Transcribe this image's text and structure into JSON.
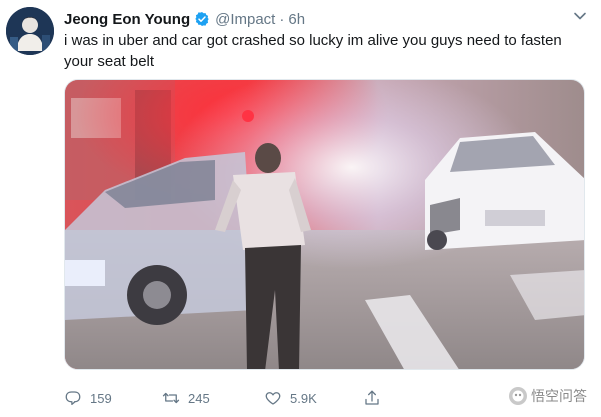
{
  "tweet": {
    "author_name": "Jeong Eon Young",
    "handle": "@Impact",
    "separator": "·",
    "time": "6h",
    "text": "i was in uber and car got crashed so lucky im alive you guys need to fasten your seat belt"
  },
  "actions": {
    "reply_count": "159",
    "retweet_count": "245",
    "like_count": "5.9K"
  },
  "icons": {
    "verified": "verified-badge-icon",
    "caret": "chevron-down-icon",
    "reply": "reply-icon",
    "retweet": "retweet-icon",
    "like": "heart-icon",
    "share": "share-icon"
  },
  "watermark": {
    "text": "悟空问答"
  },
  "colors": {
    "text": "#14171a",
    "secondary": "#657786",
    "verified": "#1da1f2",
    "border": "#e1e8ed"
  }
}
